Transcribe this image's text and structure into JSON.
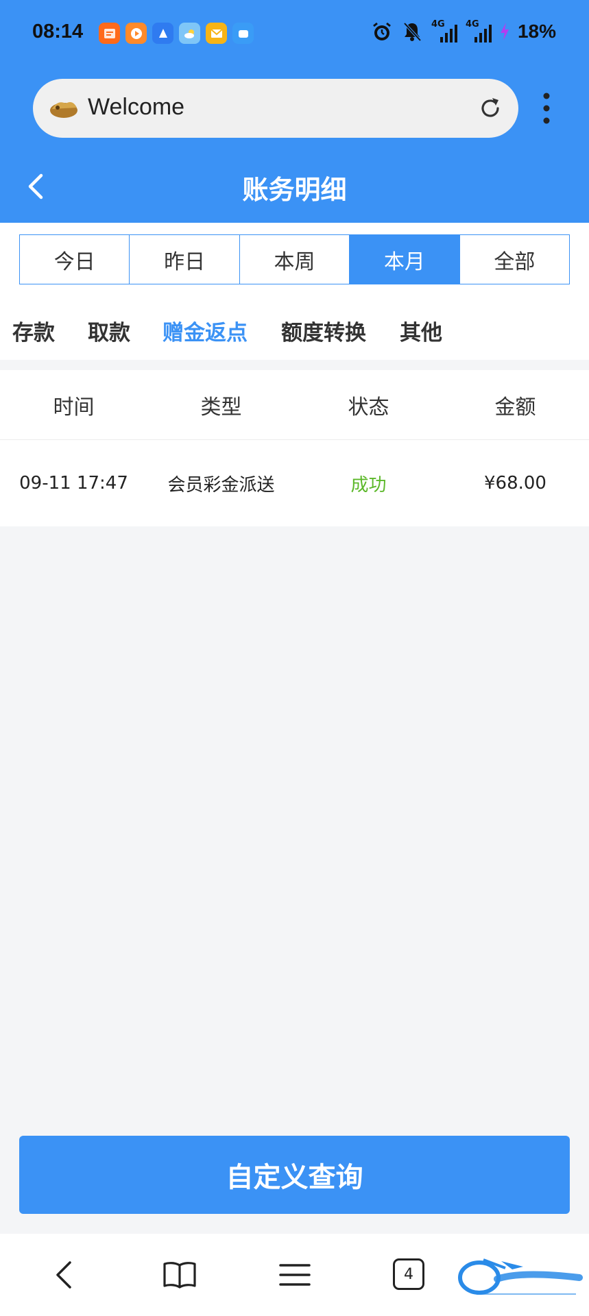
{
  "status_bar": {
    "time": "08:14",
    "battery": "18%",
    "network_1": "4G",
    "network_2": "4G",
    "icons": [
      "taobao-app-icon",
      "video-app-icon",
      "browser-app-icon",
      "weather-app-icon",
      "mail-app-icon",
      "cloud-app-icon",
      "alarm-icon",
      "mute-icon",
      "signal-icon",
      "charging-icon"
    ]
  },
  "browser": {
    "url_text": "Welcome",
    "tabs_count": "4"
  },
  "header": {
    "title": "账务明细"
  },
  "period_tabs": [
    {
      "label": "今日",
      "active": false
    },
    {
      "label": "昨日",
      "active": false
    },
    {
      "label": "本周",
      "active": false
    },
    {
      "label": "本月",
      "active": true
    },
    {
      "label": "全部",
      "active": false
    }
  ],
  "category_tabs": [
    {
      "label": "存款",
      "active": false
    },
    {
      "label": "取款",
      "active": false
    },
    {
      "label": "赠金返点",
      "active": true
    },
    {
      "label": "额度转换",
      "active": false
    },
    {
      "label": "其他",
      "active": false
    }
  ],
  "table": {
    "columns": [
      "时间",
      "类型",
      "状态",
      "金额"
    ],
    "rows": [
      {
        "time": "09-11 17:47",
        "type": "会员彩金派送",
        "status": "成功",
        "amount": "¥68.00"
      }
    ]
  },
  "query_button": "自定义查询",
  "colors": {
    "primary": "#3b92f5",
    "success": "#5cb82a",
    "background": "#f4f5f7"
  }
}
